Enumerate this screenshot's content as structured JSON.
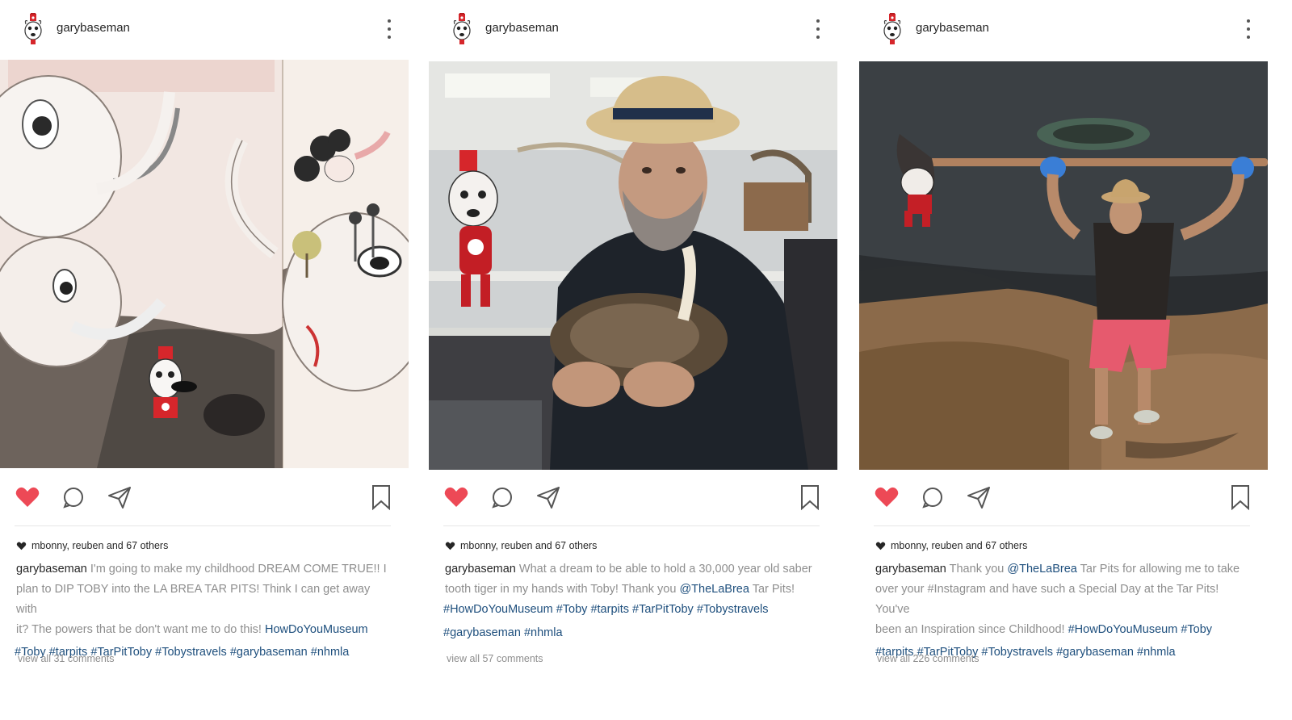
{
  "posts": [
    {
      "username": "garybaseman",
      "likes_text": "mbonny, reuben and 67 others",
      "caption_user": "garybaseman",
      "caption_lines": [
        "I'm going to make my childhood DREAM COME TRUE!! I",
        "plan to DIP TOBY into the LA BREA TAR PITS! Think I can get away with",
        "it? The powers that be don't want me to do this!"
      ],
      "caption_link": "HowDoYouMuseum",
      "hashtags": [
        "#Toby",
        "#tarpits",
        "#TarPitToby",
        "#Tobystravels",
        "#garybaseman",
        "#nhmla"
      ],
      "comments_text": "view all 31 comments",
      "photo_desc": "drawing"
    },
    {
      "username": "garybaseman",
      "likes_text": "mbonny, reuben and 67 others",
      "caption_user": "garybaseman",
      "caption_lines": [
        "What a dream to be able to hold a 30,000 year old saber",
        "tooth tiger in my hands with Toby! Thank you"
      ],
      "mention": "@TheLaBrea",
      "mention_after": "Tar Pits!",
      "hashtags_line1": [
        "#HowDoYouMuseum",
        "#Toby",
        "#tarpits",
        "#TarPitToby",
        "#Tobystravels"
      ],
      "hashtags_line2": [
        "#garybaseman",
        "#nhmla"
      ],
      "comments_text": "view all 57 comments"
    },
    {
      "username": "garybaseman",
      "likes_text": "mbonny, reuben and 67 others",
      "caption_user": "garybaseman",
      "caption_before_mention": "Thank you",
      "mention": "@TheLaBrea",
      "caption_after_mention": "Tar Pits for allowing me to take",
      "caption_lines": [
        "over your #Instagram and have such a Special Day at the Tar Pits! You've",
        "been an Inspiration since Childhood!"
      ],
      "hashtags_line1": [
        "#HowDoYouMuseum",
        "#Toby"
      ],
      "hashtags_line2": [
        "#tarpits",
        "#TarPitToby",
        "#Tobystravels",
        "#garybaseman",
        "#nhmla"
      ],
      "comments_text": "view all 226 comments"
    }
  ],
  "colors": {
    "like_red": "#ed4956",
    "hashtag_blue": "#1e4f7d",
    "muted_gray": "#8e8e8e",
    "text_dark": "#262626"
  },
  "icons": [
    "toby-avatar-icon",
    "more-options-icon",
    "heart-icon",
    "comment-icon",
    "share-icon",
    "bookmark-icon"
  ]
}
